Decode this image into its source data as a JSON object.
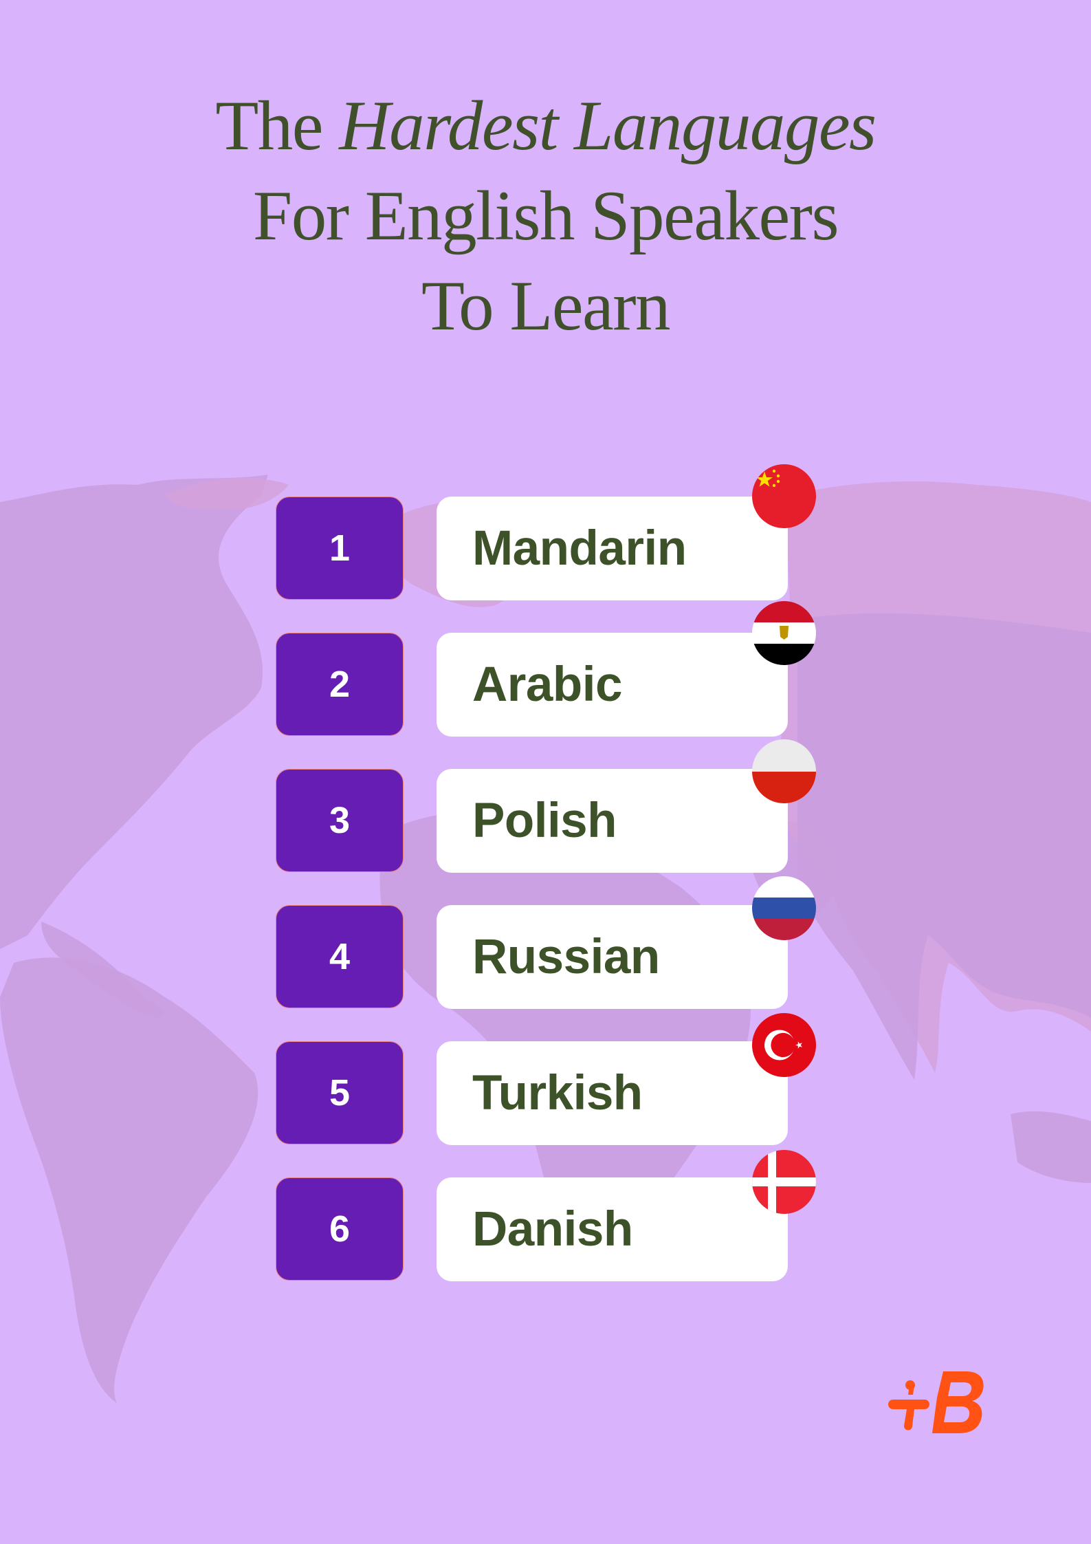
{
  "title": {
    "line1_prefix": "The ",
    "line1_emphasis": "Hardest Languages",
    "line2": "For English Speakers",
    "line3": "To Learn"
  },
  "languages": [
    {
      "rank": "1",
      "name": "Mandarin",
      "flag": "china-flag-icon"
    },
    {
      "rank": "2",
      "name": "Arabic",
      "flag": "egypt-flag-icon"
    },
    {
      "rank": "3",
      "name": "Polish",
      "flag": "poland-flag-icon"
    },
    {
      "rank": "4",
      "name": "Russian",
      "flag": "russia-flag-icon"
    },
    {
      "rank": "5",
      "name": "Turkish",
      "flag": "turkey-flag-icon"
    },
    {
      "rank": "6",
      "name": "Danish",
      "flag": "denmark-flag-icon"
    }
  ],
  "colors": {
    "background": "#d9b3fb",
    "rank_box": "#661db3",
    "rank_border": "#e8807c",
    "text_green": "#3d5229",
    "logo": "#ff5214"
  },
  "logo": {
    "name": "babbel-logo-icon"
  }
}
